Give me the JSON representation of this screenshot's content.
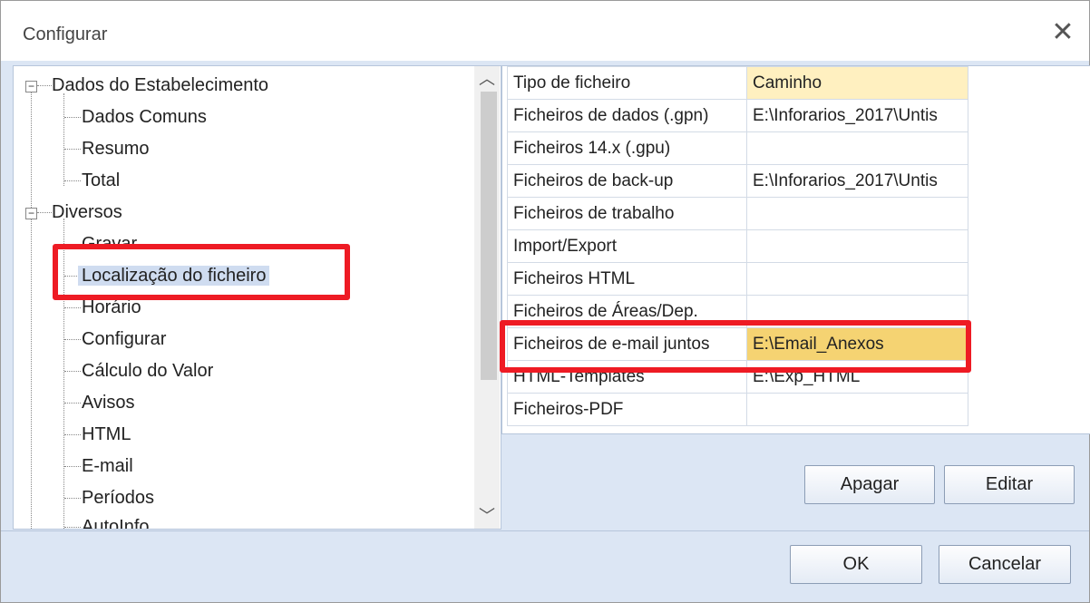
{
  "window": {
    "title": "Configurar"
  },
  "tree": {
    "groups": [
      {
        "label": "Dados do Estabelecimento",
        "children": [
          "Dados Comuns",
          "Resumo",
          "Total"
        ]
      },
      {
        "label": "Diversos",
        "children": [
          "Gravar",
          "Localização do ficheiro",
          "Horário",
          "Configurar",
          "Cálculo do Valor",
          "Avisos",
          "HTML",
          "E-mail",
          "Períodos",
          "AutoInfo"
        ]
      }
    ],
    "selected": "Localização do ficheiro",
    "scroll_up": "^",
    "scroll_down": "v"
  },
  "grid": {
    "headers": [
      "Tipo de ficheiro",
      "Caminho"
    ],
    "rows": [
      [
        "Ficheiros de dados (.gpn)",
        "E:\\Inforarios_2017\\Untis"
      ],
      [
        "Ficheiros 14.x (.gpu)",
        ""
      ],
      [
        "Ficheiros de back-up",
        "E:\\Inforarios_2017\\Untis"
      ],
      [
        "Ficheiros de trabalho",
        ""
      ],
      [
        "Import/Export",
        ""
      ],
      [
        "Ficheiros HTML",
        ""
      ],
      [
        "Ficheiros de Áreas/Dep.",
        ""
      ],
      [
        "Ficheiros de e-mail juntos",
        "E:\\Email_Anexos"
      ],
      [
        "HTML-Templates",
        "E:\\Exp_HTML"
      ],
      [
        "Ficheiros-PDF",
        ""
      ]
    ],
    "highlighted_row": 7
  },
  "buttons": {
    "delete": "Apagar",
    "edit": "Editar",
    "ok": "OK",
    "cancel": "Cancelar"
  },
  "colors": {
    "annotation": "#ee1b24",
    "selected_cell": "#f5d372",
    "header_cell": "#fff0c0"
  },
  "icons": {
    "close": "close-icon"
  }
}
